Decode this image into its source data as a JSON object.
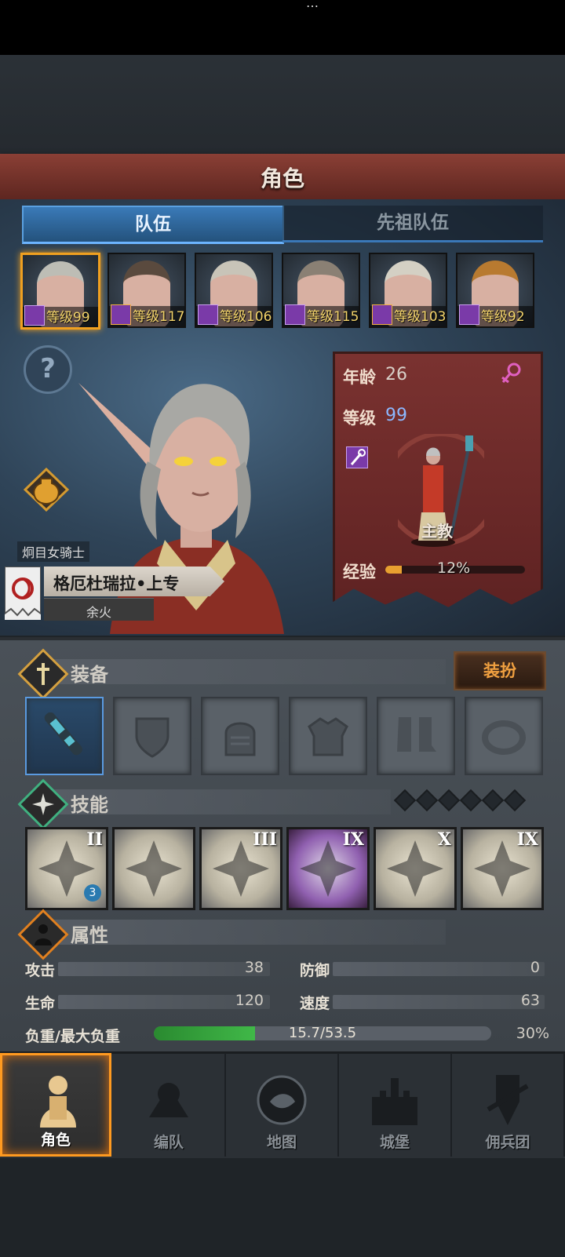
{
  "status_bar": {
    "text": "…"
  },
  "header": {
    "title": "角色"
  },
  "tabs": [
    {
      "label": "队伍",
      "active": true
    },
    {
      "label": "先祖队伍",
      "active": false
    }
  ],
  "roster": [
    {
      "level": "等级99",
      "selected": true,
      "hair": "#bdbdb5",
      "badge": "staff"
    },
    {
      "level": "等级117",
      "selected": false,
      "hair": "#5a4a3e",
      "badge": "sword-star"
    },
    {
      "level": "等级106",
      "selected": false,
      "hair": "#c8c4b8",
      "badge": "staff"
    },
    {
      "level": "等级115",
      "selected": false,
      "hair": "#8a8074",
      "badge": "staff"
    },
    {
      "level": "等级103",
      "selected": false,
      "hair": "#d4d0c4",
      "badge": "staff-star"
    },
    {
      "level": "等级92",
      "selected": false,
      "hair": "#b87a30",
      "badge": "staff"
    }
  ],
  "character": {
    "class_title": "炯目女骑士",
    "name": "格厄杜瑞拉•上专",
    "trait": "余火",
    "age_label": "年龄",
    "age": "26",
    "gender_icon": "female-icon",
    "level_label": "等级",
    "level": "99",
    "class_name": "主教",
    "xp_label": "经验",
    "xp_percent": "12%",
    "xp_fraction": 0.12
  },
  "equipment": {
    "section_label": "装备",
    "dress_button": "装扮",
    "slots": [
      "staff-icon",
      "shield-slot-icon",
      "helmet-slot-icon",
      "armor-slot-icon",
      "boots-slot-icon",
      "ring-slot-icon"
    ]
  },
  "skills": {
    "section_label": "技能",
    "items": [
      {
        "rank": "II",
        "style": "light"
      },
      {
        "rank": "",
        "style": "light"
      },
      {
        "rank": "III",
        "style": "light"
      },
      {
        "rank": "IX",
        "style": "purple"
      },
      {
        "rank": "X",
        "style": "light"
      },
      {
        "rank": "IX",
        "style": "light"
      }
    ],
    "extra_badge": "3"
  },
  "attributes": {
    "section_label": "属性",
    "attack_label": "攻击",
    "attack": "38",
    "defense_label": "防御",
    "defense": "0",
    "hp_label": "生命",
    "hp": "120",
    "speed_label": "速度",
    "speed": "63",
    "load_label": "负重/最大负重",
    "load_value": "15.7/53.5",
    "load_percent": "30%",
    "load_fraction": 0.3
  },
  "nav": [
    {
      "label": "角色",
      "active": true,
      "icon": "knight-icon"
    },
    {
      "label": "编队",
      "active": false,
      "icon": "formation-icon"
    },
    {
      "label": "地图",
      "active": false,
      "icon": "map-icon"
    },
    {
      "label": "城堡",
      "active": false,
      "icon": "castle-icon"
    },
    {
      "label": "佣兵团",
      "active": false,
      "icon": "mercenary-icon"
    }
  ]
}
